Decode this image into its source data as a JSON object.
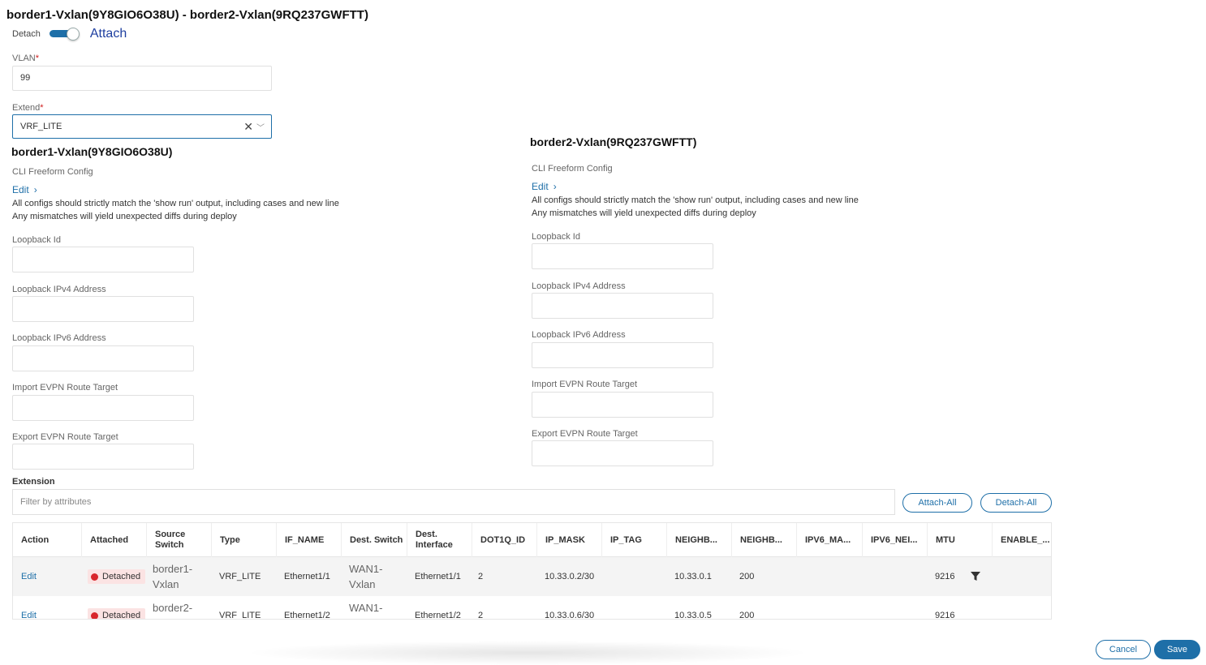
{
  "title": "border1-Vxlan(9Y8GIO6O38U) - border2-Vxlan(9RQ237GWFTT)",
  "toggle": {
    "left_label": "Detach",
    "right_label": "Attach",
    "state": "Attach"
  },
  "vlan": {
    "label": "VLAN",
    "required": "*",
    "value": "99"
  },
  "extend": {
    "label": "Extend",
    "required": "*",
    "value": "VRF_LITE"
  },
  "switches": [
    {
      "name": "border1-Vxlan(9Y8GIO6O38U)",
      "cli_label": "CLI Freeform Config",
      "edit_label": "Edit",
      "note1": "All configs should strictly match the 'show run' output, including cases and new line",
      "note2": "Any mismatches will yield unexpected diffs during deploy",
      "fields": [
        "Loopback Id",
        "Loopback IPv4 Address",
        "Loopback IPv6 Address",
        "Import EVPN Route Target",
        "Export EVPN Route Target"
      ]
    },
    {
      "name": "border2-Vxlan(9RQ237GWFTT)",
      "cli_label": "CLI Freeform Config",
      "edit_label": "Edit",
      "note1": "All configs should strictly match the 'show run' output, including cases and new line",
      "note2": "Any mismatches will yield unexpected diffs during deploy",
      "fields": [
        "Loopback Id",
        "Loopback IPv4 Address",
        "Loopback IPv6 Address",
        "Import EVPN Route Target",
        "Export EVPN Route Target"
      ]
    }
  ],
  "extension": {
    "label": "Extension",
    "filter_placeholder": "Filter by attributes",
    "attach_all": "Attach-All",
    "detach_all": "Detach-All",
    "columns": [
      "Action",
      "Attached",
      "Source Switch",
      "Type",
      "IF_NAME",
      "Dest. Switch",
      "Dest. Interface",
      "DOT1Q_ID",
      "IP_MASK",
      "IP_TAG",
      "NEIGHB...",
      "NEIGHB...",
      "IPV6_MA...",
      "IPV6_NEI...",
      "MTU",
      "ENABLE_..."
    ],
    "rows": [
      {
        "action": "Edit",
        "attached": "Detached",
        "source_switch": "border1-Vxlan",
        "type": "VRF_LITE",
        "if_name": "Ethernet1/1",
        "dest_switch": "WAN1-Vxlan",
        "dest_interface": "Ethernet1/1",
        "dot1q_id": "2",
        "ip_mask": "10.33.0.2/30",
        "ip_tag": "",
        "neighbor_ip": "10.33.0.1",
        "neighbor_asn": "200",
        "ipv6_mask": "",
        "ipv6_neighbor": "",
        "mtu": "9216",
        "enable": ""
      },
      {
        "action": "Edit",
        "attached": "Detached",
        "source_switch": "border2-",
        "type": "VRF_LITE",
        "if_name": "Ethernet1/2",
        "dest_switch": "WAN1-",
        "dest_interface": "Ethernet1/2",
        "dot1q_id": "2",
        "ip_mask": "10.33.0.6/30",
        "ip_tag": "",
        "neighbor_ip": "10.33.0.5",
        "neighbor_asn": "200",
        "ipv6_mask": "",
        "ipv6_neighbor": "",
        "mtu": "9216",
        "enable": ""
      }
    ],
    "status_color": "#d8262c"
  },
  "footer": {
    "cancel": "Cancel",
    "save": "Save"
  },
  "colors": {
    "accent": "#1e6fa8",
    "attach_text": "#1e3fa0",
    "required": "#d02020"
  }
}
